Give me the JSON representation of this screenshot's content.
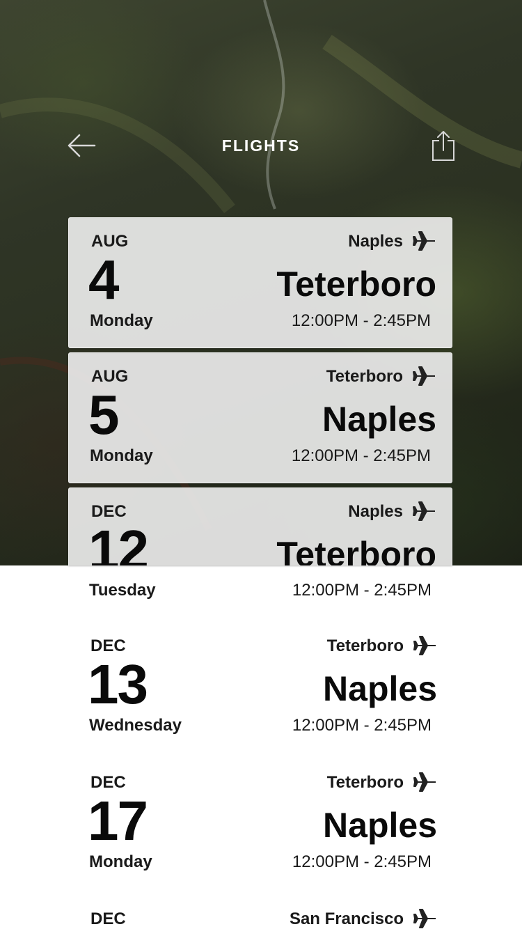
{
  "header": {
    "title": "FLIGHTS",
    "back_icon": "arrow-left-icon",
    "share_icon": "share-icon"
  },
  "flights": [
    {
      "month": "AUG",
      "day": "4",
      "weekday": "Monday",
      "origin": "Naples",
      "destination": "Teterboro",
      "times": "12:00PM - 2:45PM"
    },
    {
      "month": "AUG",
      "day": "5",
      "weekday": "Monday",
      "origin": "Teterboro",
      "destination": "Naples",
      "times": "12:00PM - 2:45PM"
    },
    {
      "month": "DEC",
      "day": "12",
      "weekday": "Tuesday",
      "origin": "Naples",
      "destination": "Teterboro",
      "times": "12:00PM - 2:45PM"
    },
    {
      "month": "DEC",
      "day": "13",
      "weekday": "Wednesday",
      "origin": "Teterboro",
      "destination": "Naples",
      "times": "12:00PM - 2:45PM"
    },
    {
      "month": "DEC",
      "day": "17",
      "weekday": "Monday",
      "origin": "Teterboro",
      "destination": "Naples",
      "times": "12:00PM - 2:45PM"
    },
    {
      "month": "DEC",
      "day": "",
      "weekday": "",
      "origin": "San Francisco",
      "destination": "",
      "times": ""
    }
  ],
  "colors": {
    "card_background": "#f0f0f0",
    "text": "#0a0a0a",
    "header_text": "#ffffff"
  }
}
